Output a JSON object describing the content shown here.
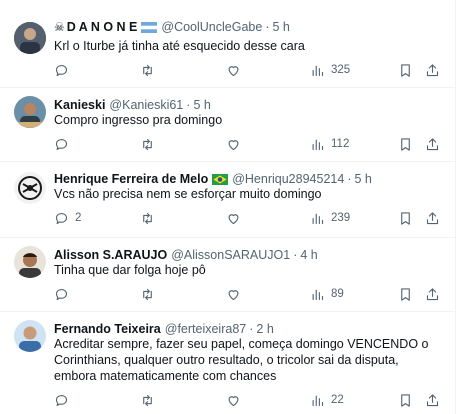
{
  "tweets": [
    {
      "name": "D A N O N E",
      "name_prefix": "☠",
      "handle": "@CoolUncleGabe",
      "time": "5 h",
      "text": "Krl o Iturbe já tinha até esquecido desse cara",
      "replies": "",
      "retweets": "",
      "likes": "",
      "views": "325"
    },
    {
      "name": "Kanieski",
      "handle": "@Kanieski61",
      "time": "5 h",
      "text": "Compro ingresso pra domingo",
      "replies": "",
      "retweets": "",
      "likes": "",
      "views": "112"
    },
    {
      "name": "Henrique Ferreira de Melo",
      "handle": "@Henriqu28945214",
      "time": "5 h",
      "text": "Vcs não precisa nem se esforçar muito domingo",
      "replies": "2",
      "retweets": "",
      "likes": "",
      "views": "239"
    },
    {
      "name": "Alisson S.ARAUJO",
      "handle": "@AlissonSARAUJO1",
      "time": "4 h",
      "text": "Tinha que dar folga hoje pô",
      "replies": "",
      "retweets": "",
      "likes": "",
      "views": "89"
    },
    {
      "name": "Fernando Teixeira",
      "handle": "@ferteixeira87",
      "time": "2 h",
      "text": "Acreditar sempre, fazer seu papel, começa domingo VENCENDO o Corinthians, qualquer outro resultado, o tricolor sai da disputa, embora matematicamente com chances",
      "replies": "",
      "retweets": "",
      "likes": "",
      "views": "22"
    }
  ],
  "colors": {
    "text_primary": "#0f1419",
    "text_secondary": "#536471",
    "divider": "#eff3f4"
  },
  "icons": [
    "reply-icon",
    "retweet-icon",
    "like-icon",
    "views-icon",
    "bookmark-icon",
    "share-icon",
    "flag-icon"
  ]
}
